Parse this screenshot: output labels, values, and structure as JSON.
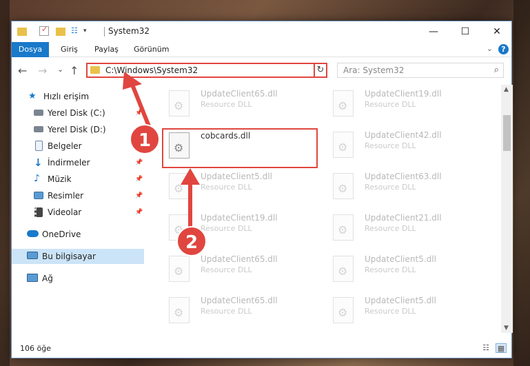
{
  "window": {
    "title": "System32",
    "minimize": "—",
    "maximize": "☐",
    "close": "✕"
  },
  "ribbon": {
    "tabs": [
      "Dosya",
      "Giriş",
      "Paylaş",
      "Görünüm"
    ],
    "help": "?",
    "collapse": "⌄"
  },
  "nav": {
    "back": "←",
    "forward": "→",
    "recent": "⌄",
    "up": "↑",
    "address": "C:\\Windows\\System32",
    "address_drop": "⌄",
    "refresh": "↻",
    "search_placeholder": "Ara: System32",
    "search_icon": "⌕"
  },
  "sidebar": {
    "items": [
      {
        "label": "Hızlı erişim",
        "icon": "star-icon",
        "pinned": false
      },
      {
        "label": "Yerel Disk (C:)",
        "icon": "drive-icon",
        "pinned": true
      },
      {
        "label": "Yerel Disk (D:)",
        "icon": "drive-icon",
        "pinned": true
      },
      {
        "label": "Belgeler",
        "icon": "document-icon",
        "pinned": true
      },
      {
        "label": "İndirmeler",
        "icon": "download-icon",
        "pinned": true
      },
      {
        "label": "Müzik",
        "icon": "music-icon",
        "pinned": true
      },
      {
        "label": "Resimler",
        "icon": "pictures-icon",
        "pinned": true
      },
      {
        "label": "Videolar",
        "icon": "video-icon",
        "pinned": true
      },
      {
        "label": "OneDrive",
        "icon": "cloud-icon",
        "pinned": false
      },
      {
        "label": "Bu bilgisayar",
        "icon": "computer-icon",
        "pinned": false,
        "selected": true
      },
      {
        "label": "Ağ",
        "icon": "network-icon",
        "pinned": false
      }
    ]
  },
  "files": [
    {
      "name": "UpdateClient65.dll",
      "type": "Resource DLL"
    },
    {
      "name": "UpdateClient19.dll",
      "type": "Resource DLL"
    },
    {
      "name": "cobcards.dll",
      "type": ""
    },
    {
      "name": "UpdateClient42.dll",
      "type": "Resource DLL"
    },
    {
      "name": "UpdateClient5.dll",
      "type": "Resource DLL"
    },
    {
      "name": "UpdateClient63.dll",
      "type": "Resource DLL"
    },
    {
      "name": "UpdateClient19.dll",
      "type": "Resource DLL"
    },
    {
      "name": "UpdateClient21.dll",
      "type": "Resource DLL"
    },
    {
      "name": "UpdateClient65.dll",
      "type": "Resource DLL"
    },
    {
      "name": "UpdateClient5.dll",
      "type": "Resource DLL"
    },
    {
      "name": "UpdateClient65.dll",
      "type": "Resource DLL"
    },
    {
      "name": "UpdateClient5.dll",
      "type": "Resource DLL"
    }
  ],
  "status": {
    "count": "106 öğe",
    "details_view": "☷",
    "tiles_view": "▦"
  },
  "annotations": {
    "step1": "1",
    "step2": "2"
  },
  "colors": {
    "accent": "#1979ca",
    "highlight": "#e0463f"
  }
}
